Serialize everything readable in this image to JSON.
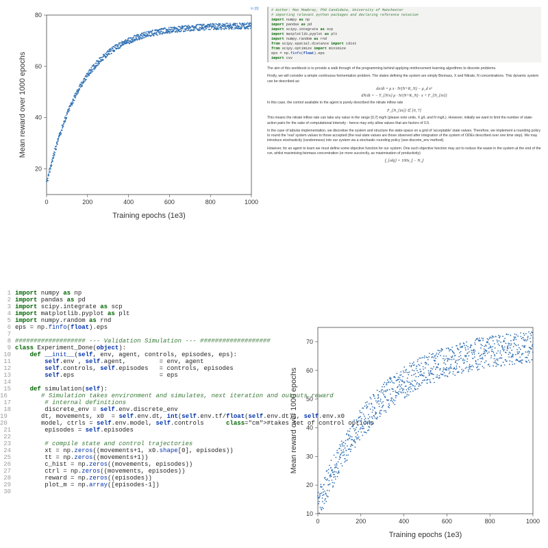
{
  "chart_data": [
    {
      "id": "chart-top-left",
      "type": "scatter",
      "xlabel": "Training epochs (1e3)",
      "ylabel": "Mean reward over 1000 epochs",
      "xlim": [
        0,
        1000
      ],
      "ylim": [
        10,
        80
      ],
      "xticks": [
        0,
        200,
        400,
        600,
        800,
        1000
      ],
      "yticks": [
        20,
        40,
        60,
        80
      ],
      "n_points": 1000,
      "curve_approx": {
        "y0": 14,
        "ymax": 76,
        "k": 0.0058,
        "noise": 1.2
      }
    },
    {
      "id": "chart-bottom-right",
      "type": "scatter",
      "xlabel": "Training epochs (1e3)",
      "ylabel": "Mean reward over 1000 epochs",
      "xlim": [
        0,
        1000
      ],
      "ylim": [
        10,
        75
      ],
      "xticks": [
        0,
        200,
        400,
        600,
        800,
        1000
      ],
      "yticks": [
        10,
        20,
        30,
        40,
        50,
        60,
        70
      ],
      "n_points": 1000,
      "curve_approx": {
        "y0": 12,
        "ymax": 70,
        "k": 0.0035,
        "noise": 5.5
      }
    }
  ],
  "notebook": {
    "label": "In [8]:",
    "code_lines": [
      {
        "cls": "cm",
        "t": "# Author: Max Mowbray, PhD Candidate, University of Manchester"
      },
      {
        "cls": "cm",
        "t": "# importing relevant python packages and declaring reference notation"
      },
      {
        "cls": "",
        "t": "import numpy as np"
      },
      {
        "cls": "",
        "t": "import pandas as pd"
      },
      {
        "cls": "",
        "t": "import scipy.integrate as scp"
      },
      {
        "cls": "",
        "t": "import matplotlib.pyplot as plt"
      },
      {
        "cls": "",
        "t": "import numpy.random as rnd"
      },
      {
        "cls": "",
        "t": "from scipy.spatial.distance import cdist"
      },
      {
        "cls": "",
        "t": "from scipy.optimize import minimize"
      },
      {
        "cls": "",
        "t": "eps = np.finfo(float).eps"
      },
      {
        "cls": "",
        "t": "import csv"
      }
    ],
    "prose": [
      "The aim of this workbook is to provide a walk through of the programming behind applying reinforcement learning algorithms to discrete problems.",
      "Firstly, we will consider a simple continuous fermentation problem. The states defining the system are simply Biomass, X and Nitrate, N concentrations. This dynamic system can be described as:"
    ],
    "equations": [
      "dx/dt = μ x · N/(N+K_N) − μ_d x²",
      "dN/dt = − Y_{N/x} μ · N/(N+K_N) · x + F_{N_{in}}"
    ],
    "prose2": "In this case, the control available to the agent is purely described the nitrate inflow rate",
    "equation2": "F_{N_{in}} ∈ [0, 7]",
    "prose3": "This means the nitrate inflow rate can take any value in the range [0,7] mg/h (please note units, X g/L and N mg/L). However, initially we want to limit the number of state-action pairs for the sake of computational intensity - hence may only allow values that are factors of 0.5.",
    "prose4": "In the case of tabular implementation, we discretise the system and structure the state-space on a grid of 'acceptable' state values. Therefore, we implement a rounding policy to round the 'real' system values to those accepted (the real state values are those observed after integration of the system of ODEs described over one time step). We may introduce stochasticity (randomness) into our system via a stochastic rounding policy (see discrete_env method).",
    "prose5": "However, for an agent to learn we must define some objective function for our system. One such objective function may act to reduce the waste in the system at the end of the run, whilst maximising biomass concentration (or more succinctly, as maximisation of productivity)",
    "equation3": "f_{obj} = 100x_f − N_f"
  },
  "codeblock": {
    "lines": [
      "import numpy as np",
      "import pandas as pd",
      "import scipy.integrate as scp",
      "import matplotlib.pyplot as plt",
      "import numpy.random as rnd",
      "eps = np.finfo(float).eps",
      "",
      "################### --- Validation Simulation --- ###################",
      "class Experiment_Done(object):",
      "    def __init__(self, env, agent, controls, episodes, eps):",
      "        self.env , self.agent,         = env, agent",
      "        self.controls, self.episodes   = controls, episodes",
      "        self.eps                       = eps",
      "",
      "    def simulation(self):",
      "        # Simulation takes environment and simulates, next iteration and outputs reward",
      "        # internal definitions",
      "        discrete_env = self.env.discrete_env",
      "        dt, movements, x0  = self.env.dt, int(self.env.tf/float(self.env.dt)), self.env.x0",
      "        model, ctrls = self.env.model, self.controls      #takes set of control options",
      "        episodes = self.episodes",
      "",
      "        # compile state and control trajectories",
      "        xt = np.zeros((movements+1, x0.shape[0], episodes))",
      "        tt = np.zeros((movements+1))",
      "        c_hist = np.zeros((movements, episodes))",
      "        ctrl = np.zeros((movements, episodes))",
      "        reward = np.zeros((episodes))",
      "        plot_m = np.array([episodes-1])",
      ""
    ]
  }
}
